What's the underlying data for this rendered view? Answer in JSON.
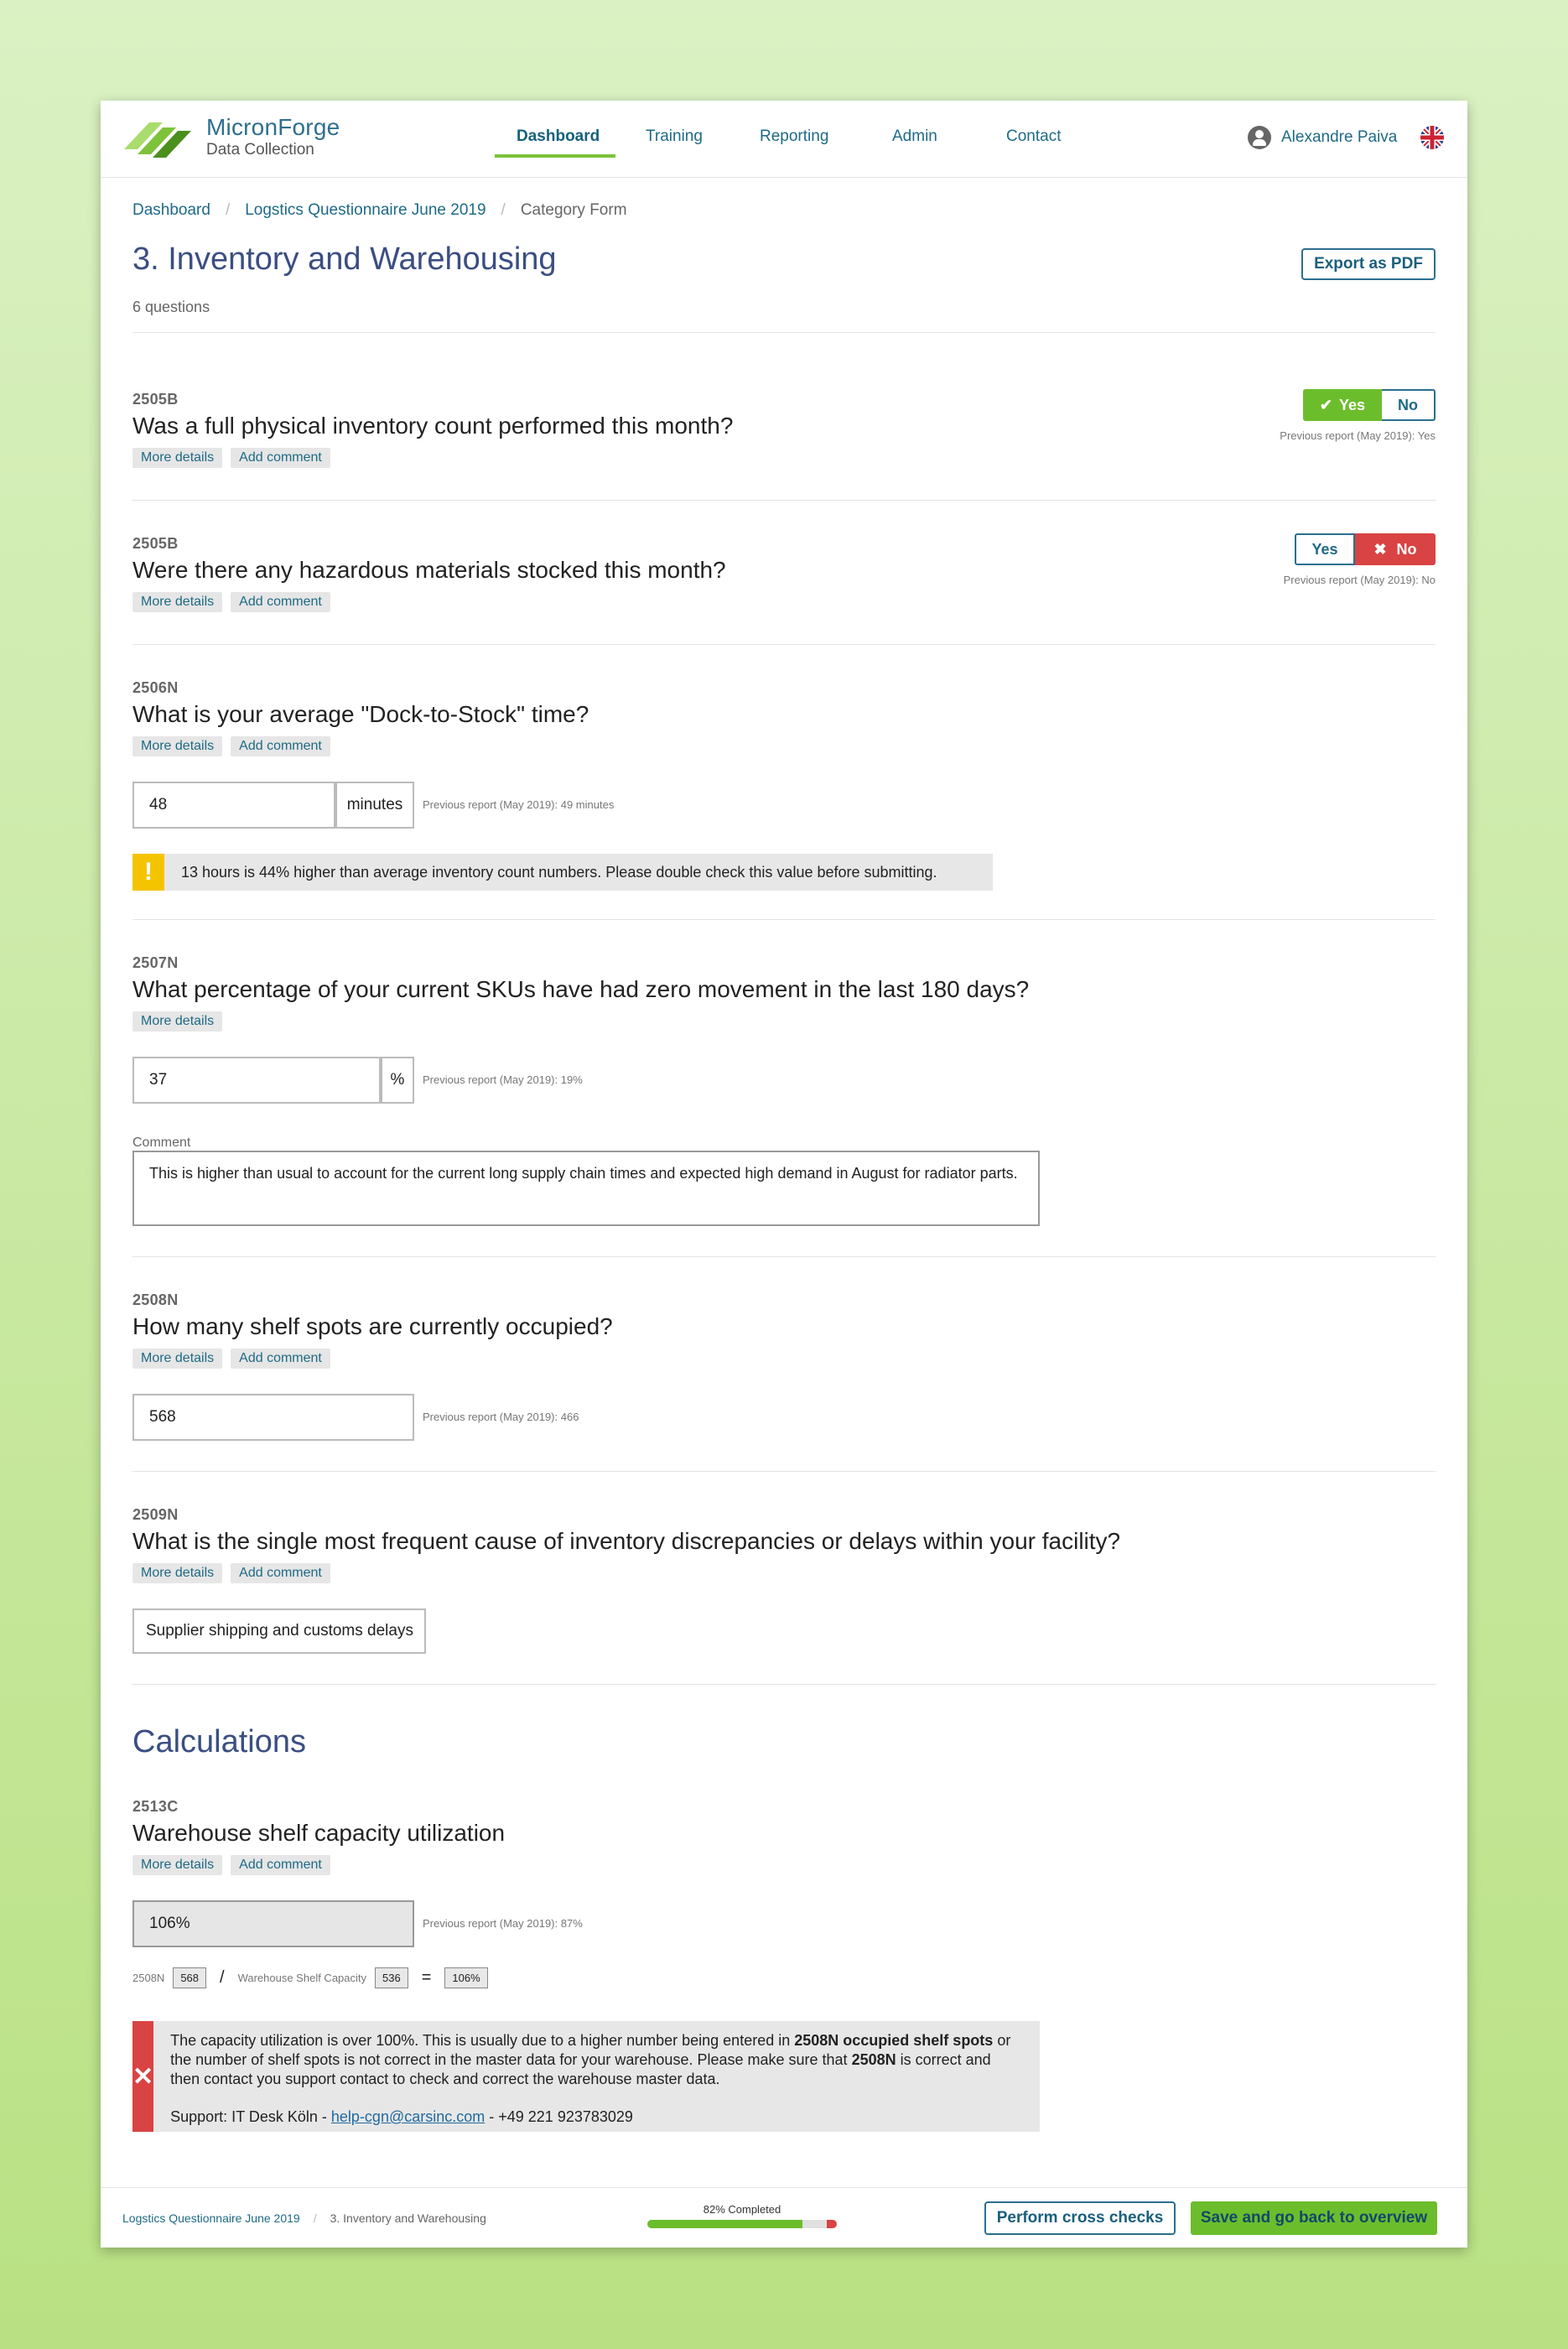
{
  "brand": {
    "name": "MicronForge",
    "subtitle": "Data Collection"
  },
  "nav": {
    "items": [
      "Dashboard",
      "Training",
      "Reporting",
      "Admin",
      "Contact"
    ],
    "active": "Dashboard"
  },
  "user": {
    "name": "Alexandre Paiva"
  },
  "breadcrumb": [
    "Dashboard",
    "Logstics Questionnaire June 2019",
    "Category Form"
  ],
  "page": {
    "title": "3. Inventory and Warehousing",
    "subtitle": "6 questions",
    "export_label": "Export as PDF"
  },
  "tags": {
    "details": "More details",
    "comment": "Add comment"
  },
  "questions": [
    {
      "code": "2505B",
      "text": "Was a full physical inventory count performed this month?",
      "yes": "Yes",
      "no": "No",
      "selected": "Yes",
      "previous": "Previous report (May 2019): Yes"
    },
    {
      "code": "2505B",
      "text": "Were there any hazardous materials stocked this month?",
      "yes": "Yes",
      "no": "No",
      "selected": "No",
      "previous": "Previous report (May 2019): No"
    },
    {
      "code": "2506N",
      "text": "What is your average \"Dock-to-Stock\" time?",
      "value": "48",
      "unit": "minutes",
      "previous": "Previous report (May 2019): 49 minutes",
      "warning": "13 hours is 44% higher than average inventory count numbers. Please double check this value before submitting."
    },
    {
      "code": "2507N",
      "text": "What percentage of your current SKUs have had zero movement in the last 180 days?",
      "value": "37",
      "unit": "%",
      "previous": "Previous report (May 2019): 19%",
      "comment_label": "Comment",
      "comment": "This is higher than usual to account for the current long supply chain times and expected high demand in August for radiator parts."
    },
    {
      "code": "2508N",
      "text": "How many shelf spots are currently occupied?",
      "value": "568",
      "previous": "Previous report (May 2019): 466"
    },
    {
      "code": "2509N",
      "text": "What is the single most frequent cause of inventory discrepancies or delays within your facility?",
      "value": "Supplier shipping and customs delays"
    }
  ],
  "calculations": {
    "title": "Calculations",
    "code": "2513C",
    "text": "Warehouse shelf capacity utilization",
    "value": "106%",
    "previous": "Previous report (May 2019): 87%",
    "formula": {
      "a_label": "2508N",
      "a_value": "568",
      "op1": "/",
      "b_label": "Warehouse Shelf Capacity",
      "b_value": "536",
      "op2": "=",
      "result": "106%"
    },
    "error": {
      "p1": "The capacity utilization is over 100%. This is usually due to a higher number being entered in ",
      "b1": "2508N occupied shelf spots",
      "p2": " or the number of shelf spots is not correct in the master data for your warehouse. Please make sure that ",
      "b2": "2508N",
      "p3": " is correct and then contact you support contact to check and correct the warehouse master data.",
      "support_prefix": "Support: IT Desk Köln - ",
      "support_email": "help-cgn@carsinc.com",
      "support_suffix": " - +49 221 923783029"
    }
  },
  "footer": {
    "crumb1": "Logstics Questionnaire June 2019",
    "crumb2": "3. Inventory and Warehousing",
    "progress_label": "82% Completed",
    "progress": 0.82,
    "cross_checks": "Perform cross checks",
    "save": "Save and go back to overview"
  },
  "colors": {
    "accent_green": "#6cbd2c",
    "error_red": "#d94343",
    "warning_yellow": "#f5c400",
    "link_blue": "#1e6a86",
    "title_blue": "#3a4e82"
  }
}
